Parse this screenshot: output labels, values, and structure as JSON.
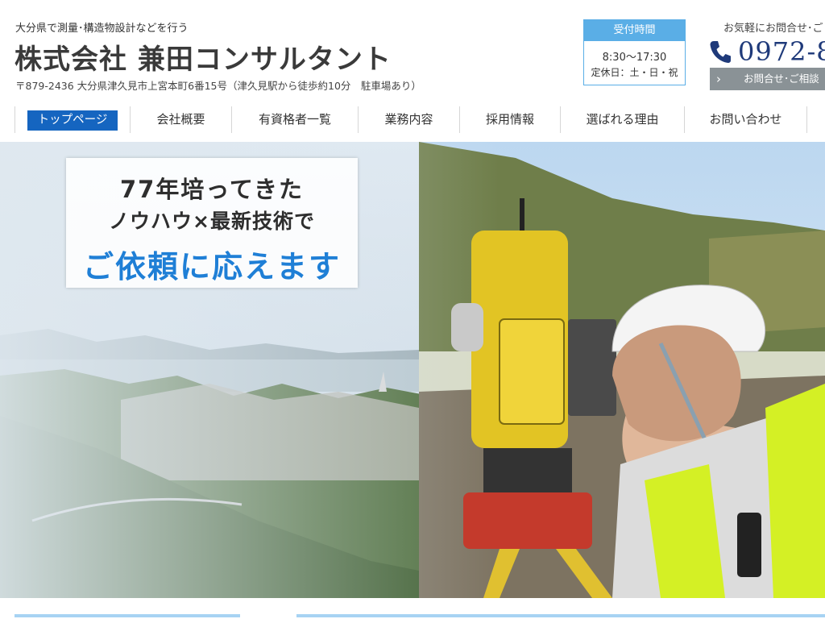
{
  "header": {
    "tagline": "大分県で測量･構造物設計などを行う",
    "company": "株式会社 兼田コンサルタント",
    "address": "〒879-2436 大分県津久見市上宮本町6番15号（津久見駅から徒歩約10分　駐車場あり）"
  },
  "hours": {
    "heading": "受付時間",
    "time": "8:30〜17:30",
    "closed": "定休日：土・日・祝"
  },
  "contact": {
    "lead": "お気軽にお問合せ･ご",
    "phone": "0972-8",
    "button_label": "お問合せ･ご相談",
    "button_icon": "chevron-right-icon",
    "phone_icon": "phone-icon"
  },
  "nav": {
    "items": [
      {
        "label": "トップページ",
        "active": true
      },
      {
        "label": "会社概要"
      },
      {
        "label": "有資格者一覧"
      },
      {
        "label": "業務内容"
      },
      {
        "label": "採用情報"
      },
      {
        "label": "選ばれる理由"
      },
      {
        "label": "お問い合わせ"
      }
    ]
  },
  "hero": {
    "line1": "77年培ってきた",
    "line2": "ノウハウ×最新技術で",
    "line3": "ご依頼に応えます"
  },
  "colors": {
    "accent": "#1565c0",
    "hours_header": "#5aaee6",
    "phone": "#1f3a7a",
    "hero_highlight": "#1f7fd6",
    "rule": "#a7d3f3"
  }
}
